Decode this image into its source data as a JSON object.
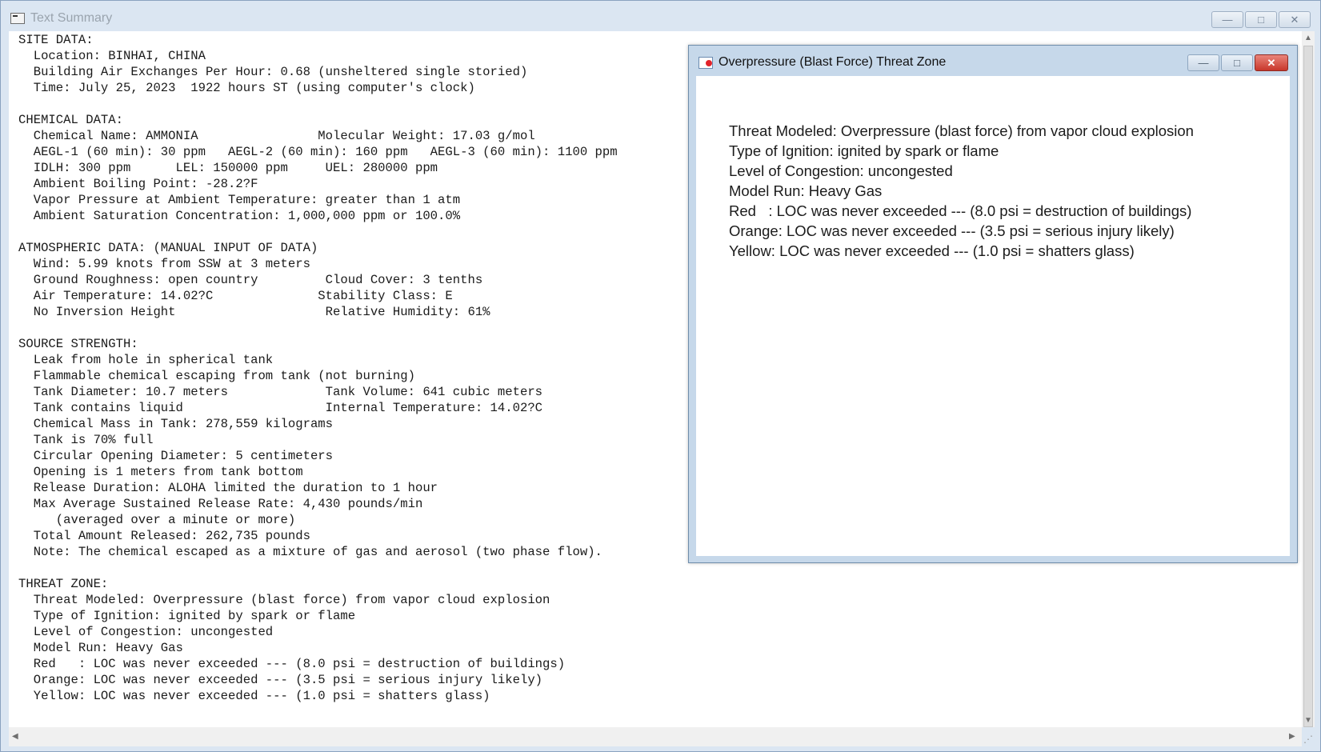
{
  "window": {
    "title": "Text Summary",
    "minimize": "—",
    "maximize": "□",
    "close": "✕"
  },
  "summary_lines": [
    "SITE DATA:",
    "  Location: BINHAI, CHINA",
    "  Building Air Exchanges Per Hour: 0.68 (unsheltered single storied)",
    "  Time: July 25, 2023  1922 hours ST (using computer's clock)",
    "",
    "CHEMICAL DATA:",
    "  Chemical Name: AMMONIA                Molecular Weight: 17.03 g/mol",
    "  AEGL-1 (60 min): 30 ppm   AEGL-2 (60 min): 160 ppm   AEGL-3 (60 min): 1100 ppm",
    "  IDLH: 300 ppm      LEL: 150000 ppm     UEL: 280000 ppm",
    "  Ambient Boiling Point: -28.2?F",
    "  Vapor Pressure at Ambient Temperature: greater than 1 atm",
    "  Ambient Saturation Concentration: 1,000,000 ppm or 100.0%",
    "",
    "ATMOSPHERIC DATA: (MANUAL INPUT OF DATA)",
    "  Wind: 5.99 knots from SSW at 3 meters",
    "  Ground Roughness: open country         Cloud Cover: 3 tenths",
    "  Air Temperature: 14.02?C              Stability Class: E",
    "  No Inversion Height                    Relative Humidity: 61%",
    "",
    "SOURCE STRENGTH:",
    "  Leak from hole in spherical tank",
    "  Flammable chemical escaping from tank (not burning)",
    "  Tank Diameter: 10.7 meters             Tank Volume: 641 cubic meters",
    "  Tank contains liquid                   Internal Temperature: 14.02?C",
    "  Chemical Mass in Tank: 278,559 kilograms",
    "  Tank is 70% full",
    "  Circular Opening Diameter: 5 centimeters",
    "  Opening is 1 meters from tank bottom",
    "  Release Duration: ALOHA limited the duration to 1 hour",
    "  Max Average Sustained Release Rate: 4,430 pounds/min",
    "     (averaged over a minute or more)",
    "  Total Amount Released: 262,735 pounds",
    "  Note: The chemical escaped as a mixture of gas and aerosol (two phase flow).",
    "",
    "THREAT ZONE:",
    "  Threat Modeled: Overpressure (blast force) from vapor cloud explosion",
    "  Type of Ignition: ignited by spark or flame",
    "  Level of Congestion: uncongested",
    "  Model Run: Heavy Gas",
    "  Red   : LOC was never exceeded --- (8.0 psi = destruction of buildings)",
    "  Orange: LOC was never exceeded --- (3.5 psi = serious injury likely)",
    "  Yellow: LOC was never exceeded --- (1.0 psi = shatters glass)"
  ],
  "child_window": {
    "title": "Overpressure (Blast Force) Threat Zone",
    "minimize": "—",
    "maximize": "□",
    "close": "✕",
    "lines": [
      "Threat Modeled: Overpressure (blast force) from vapor cloud explosion",
      "Type of Ignition: ignited by spark or flame",
      "Level of Congestion: uncongested",
      "Model Run: Heavy Gas",
      "Red   : LOC was never exceeded --- (8.0 psi = destruction of buildings)",
      "Orange: LOC was never exceeded --- (3.5 psi = serious injury likely)",
      "Yellow: LOC was never exceeded --- (1.0 psi = shatters glass)"
    ]
  },
  "scrollbars": {
    "up": "▲",
    "down": "▼",
    "left": "◀",
    "right": "▶",
    "grip": "⋰"
  },
  "icons": {
    "app": "text-summary-icon",
    "child": "aloha-map-icon"
  }
}
